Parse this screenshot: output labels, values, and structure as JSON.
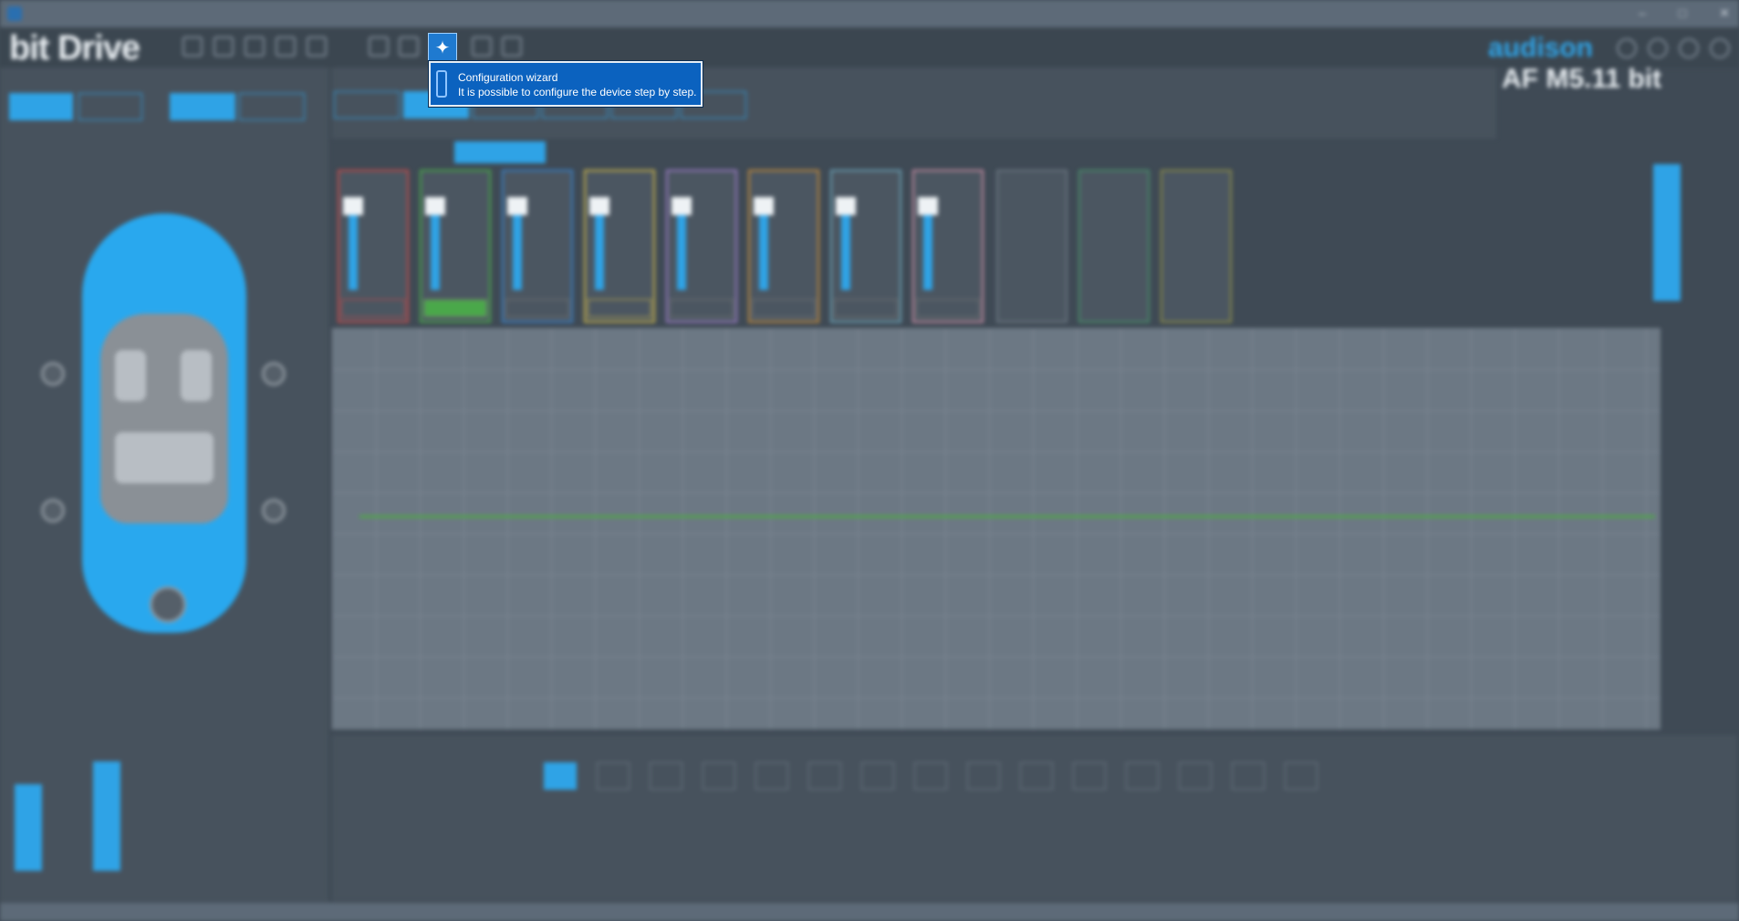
{
  "app": {
    "logo": "bit Drive",
    "brand": "audison",
    "model": "AF M5.11 bit"
  },
  "tooltip": {
    "title": "Configuration wizard",
    "description": "It is possible to configure the device step by step."
  },
  "icons": {
    "wizard": "magic-wand-icon",
    "app": "app-icon"
  },
  "colors": {
    "accent": "#2fa3e6",
    "tooltip_bg": "#0b62bf",
    "curve": "#4fa648",
    "warning": "#e38a2a"
  }
}
